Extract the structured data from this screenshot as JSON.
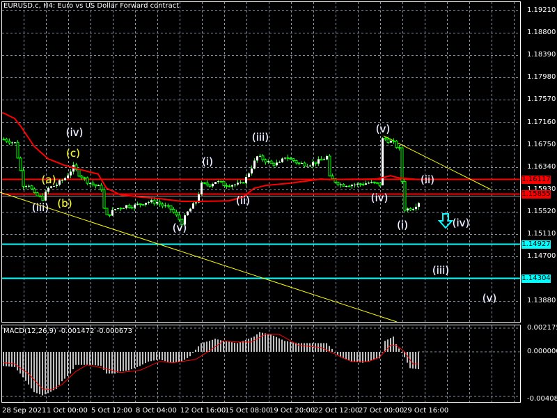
{
  "header": {
    "title": "EURUSD.c, H4:  Euro vs US Dollar Forward contract"
  },
  "macd": {
    "title": "MACD(12,26,9) -0.001472 -0.000673"
  },
  "colors": {
    "bg": "#000000",
    "grid": "#8a95a5",
    "bull_wick": "#00ff00",
    "bull_body": "#ffffff",
    "bear_body": "#000000",
    "ma": "#ff0000",
    "level_red": "#ff0000",
    "level_cyan": "#00ffff",
    "trend": "#ffff00",
    "histogram": "#c0c0c0",
    "signal": "#ff0000"
  },
  "price_axis": [
    "1.19210",
    "1.18800",
    "1.18390",
    "1.17980",
    "1.17570",
    "1.17160",
    "1.16750",
    "1.16340",
    "1.15930",
    "1.15520",
    "1.15110",
    "1.14700",
    "1.13880"
  ],
  "levels": [
    {
      "price": "1.16117",
      "color": "red"
    },
    {
      "price": "1.15855",
      "color": "red"
    },
    {
      "price": "1.14927",
      "color": "cyan"
    },
    {
      "price": "1.14304",
      "color": "cyan"
    }
  ],
  "macd_axis": [
    "0.002175",
    "0.000000",
    "-0.004081"
  ],
  "time_axis": [
    "28 Sep 2021",
    "1 Oct 00:00",
    "5 Oct 12:00",
    "8 Oct 04:00",
    "12 Oct 16:00",
    "15 Oct 08:00",
    "19 Oct 20:00",
    "22 Oct 12:00",
    "27 Oct 00:00",
    "29 Oct 16:00"
  ],
  "waves": [
    "(iv)",
    "(c)",
    "(a)",
    "(b)",
    "(iii)",
    "(v)",
    "(i)",
    "(ii)",
    "(iii)",
    "(v)",
    "(iv)",
    "(i)",
    "(ii)",
    "(iv)",
    "(iii)",
    "(v)"
  ],
  "chart_data": {
    "type": "candlestick",
    "title": "EURUSD.c, H4",
    "bars": 150,
    "price_range": [
      1.138,
      1.1921
    ],
    "close_control_points": [
      [
        0,
        1.1685
      ],
      [
        4,
        1.1678
      ],
      [
        6,
        1.1627
      ],
      [
        7,
        1.1602
      ],
      [
        9,
        1.1602
      ],
      [
        11,
        1.1583
      ],
      [
        14,
        1.1576
      ],
      [
        16,
        1.1595
      ],
      [
        19,
        1.1602
      ],
      [
        22,
        1.1614
      ],
      [
        25,
        1.1634
      ],
      [
        27,
        1.1621
      ],
      [
        30,
        1.1608
      ],
      [
        32,
        1.1602
      ],
      [
        35,
        1.1595
      ],
      [
        36,
        1.1557
      ],
      [
        37,
        1.1544
      ],
      [
        40,
        1.1557
      ],
      [
        44,
        1.1563
      ],
      [
        47,
        1.1563
      ],
      [
        51,
        1.157
      ],
      [
        55,
        1.157
      ],
      [
        57,
        1.1563
      ],
      [
        60,
        1.1557
      ],
      [
        62,
        1.1544
      ],
      [
        64,
        1.1532
      ],
      [
        66,
        1.1551
      ],
      [
        69,
        1.157
      ],
      [
        71,
        1.1602
      ],
      [
        74,
        1.1602
      ],
      [
        76,
        1.1608
      ],
      [
        79,
        1.1602
      ],
      [
        81,
        1.1602
      ],
      [
        85,
        1.1602
      ],
      [
        87,
        1.1614
      ],
      [
        89,
        1.1634
      ],
      [
        91,
        1.1653
      ],
      [
        94,
        1.1646
      ],
      [
        96,
        1.164
      ],
      [
        99,
        1.164
      ],
      [
        101,
        1.1653
      ],
      [
        104,
        1.1646
      ],
      [
        106,
        1.164
      ],
      [
        110,
        1.164
      ],
      [
        114,
        1.1646
      ],
      [
        116,
        1.1653
      ],
      [
        117,
        1.1614
      ],
      [
        121,
        1.1602
      ],
      [
        124,
        1.1602
      ],
      [
        127,
        1.1602
      ],
      [
        131,
        1.1605
      ],
      [
        135,
        1.1602
      ],
      [
        136,
        1.1685
      ],
      [
        137,
        1.1685
      ],
      [
        140,
        1.1678
      ],
      [
        142,
        1.1666
      ],
      [
        143,
        1.1608
      ],
      [
        144,
        1.1557
      ],
      [
        145,
        1.1557
      ],
      [
        147,
        1.156
      ],
      [
        149,
        1.157
      ],
      [
        150,
        1.1576
      ]
    ],
    "ma_control_points": [
      [
        0,
        1.1733
      ],
      [
        4,
        1.1723
      ],
      [
        6,
        1.171
      ],
      [
        11,
        1.1672
      ],
      [
        16,
        1.1649
      ],
      [
        22,
        1.1637
      ],
      [
        27,
        1.163
      ],
      [
        34,
        1.1621
      ],
      [
        37,
        1.1595
      ],
      [
        42,
        1.1583
      ],
      [
        49,
        1.1579
      ],
      [
        56,
        1.1576
      ],
      [
        64,
        1.1571
      ],
      [
        71,
        1.1571
      ],
      [
        81,
        1.1572
      ],
      [
        86,
        1.1579
      ],
      [
        90,
        1.1595
      ],
      [
        94,
        1.16
      ],
      [
        104,
        1.1605
      ],
      [
        114,
        1.1612
      ],
      [
        117,
        1.1611
      ],
      [
        134,
        1.1612
      ],
      [
        139,
        1.1618
      ],
      [
        142,
        1.1614
      ],
      [
        149,
        1.1611
      ]
    ],
    "macd_histogram_control_points": [
      [
        0,
        -0.0013
      ],
      [
        4,
        -0.0014
      ],
      [
        6,
        -0.002
      ],
      [
        9,
        -0.003
      ],
      [
        11,
        -0.0037
      ],
      [
        14,
        -0.004
      ],
      [
        16,
        -0.0038
      ],
      [
        19,
        -0.0034
      ],
      [
        21,
        -0.0027
      ],
      [
        24,
        -0.002
      ],
      [
        26,
        -0.0012
      ],
      [
        32,
        -0.0012
      ],
      [
        35,
        -0.0013
      ],
      [
        37,
        -0.002
      ],
      [
        40,
        -0.002
      ],
      [
        42,
        -0.0018
      ],
      [
        45,
        -0.0017
      ],
      [
        49,
        -0.0013
      ],
      [
        52,
        -0.0009
      ],
      [
        56,
        -0.0007
      ],
      [
        60,
        -0.001
      ],
      [
        64,
        -0.0009
      ],
      [
        67,
        -0.0004
      ],
      [
        71,
        0.0008
      ],
      [
        74,
        0.001
      ],
      [
        76,
        0.0012
      ],
      [
        79,
        0.001
      ],
      [
        84,
        0.0008
      ],
      [
        90,
        0.0014
      ],
      [
        92,
        0.0018
      ],
      [
        96,
        0.0016
      ],
      [
        101,
        0.001
      ],
      [
        106,
        0.0008
      ],
      [
        116,
        0.0008
      ],
      [
        119,
        0.0
      ],
      [
        121,
        -0.0005
      ],
      [
        125,
        -0.0009
      ],
      [
        129,
        -0.001
      ],
      [
        135,
        -0.0006
      ],
      [
        136,
        0.0
      ],
      [
        137,
        0.001
      ],
      [
        140,
        0.0014
      ],
      [
        141,
        0.0007
      ],
      [
        144,
        -0.0005
      ],
      [
        146,
        -0.0015
      ],
      [
        149,
        -0.0016
      ]
    ],
    "macd_signal_control_points": [
      [
        0,
        -0.001
      ],
      [
        4,
        -0.0011
      ],
      [
        9,
        -0.002
      ],
      [
        14,
        -0.0034
      ],
      [
        17,
        -0.0035
      ],
      [
        21,
        -0.003
      ],
      [
        26,
        -0.0018
      ],
      [
        30,
        -0.0012
      ],
      [
        32,
        -0.0013
      ],
      [
        36,
        -0.0015
      ],
      [
        42,
        -0.0019
      ],
      [
        49,
        -0.0017
      ],
      [
        56,
        -0.0009
      ],
      [
        61,
        -0.001
      ],
      [
        69,
        -0.0007
      ],
      [
        74,
        0.0001
      ],
      [
        79,
        0.001
      ],
      [
        84,
        0.0009
      ],
      [
        89,
        0.0009
      ],
      [
        94,
        0.0016
      ],
      [
        99,
        0.0016
      ],
      [
        106,
        0.0006
      ],
      [
        114,
        0.0004
      ],
      [
        119,
        -0.0002
      ],
      [
        125,
        -0.0009
      ],
      [
        131,
        -0.0009
      ],
      [
        135,
        -0.0005
      ],
      [
        139,
        0.0006
      ],
      [
        141,
        0.0006
      ],
      [
        144,
        0.0
      ],
      [
        147,
        -0.0011
      ]
    ],
    "macd_range": [
      -0.004081,
      0.002175
    ]
  }
}
